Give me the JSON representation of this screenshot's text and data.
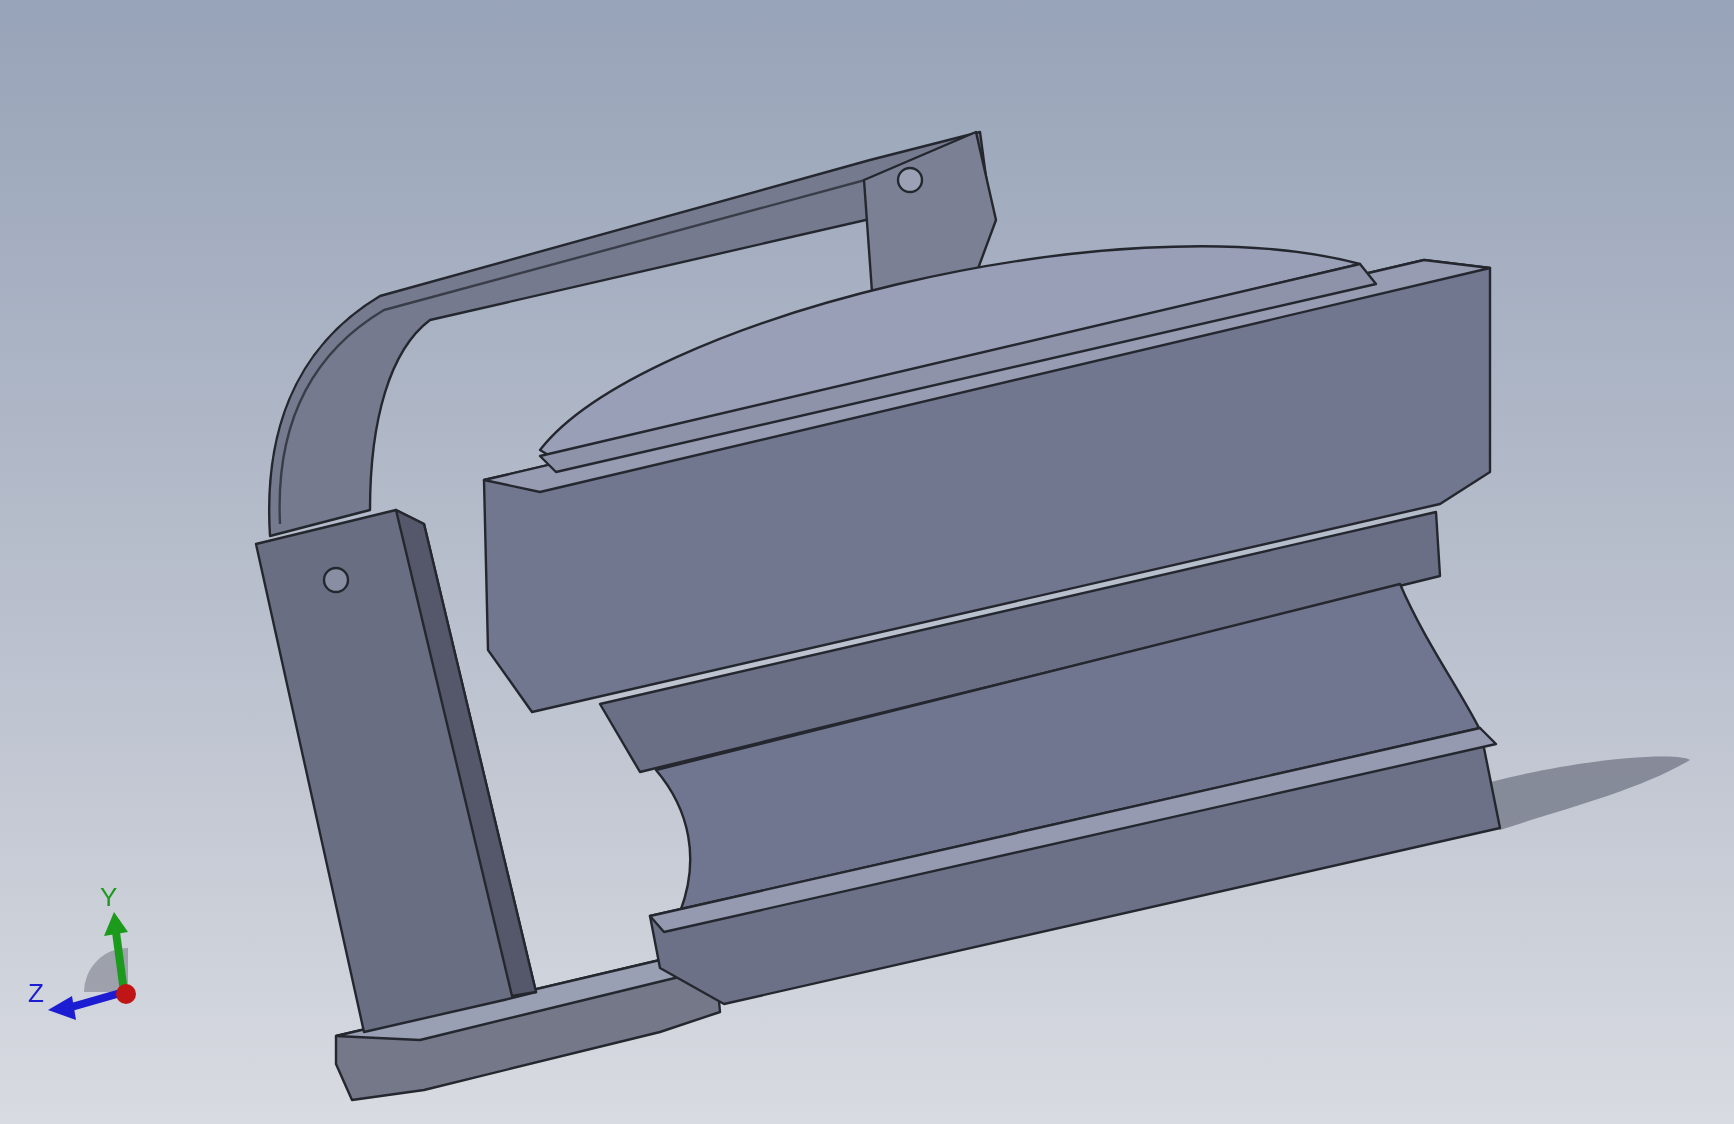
{
  "triad": {
    "axes": [
      {
        "label": "Y",
        "color": "#1c9a1c"
      },
      {
        "label": "Z",
        "color": "#1c1cd2"
      }
    ]
  }
}
